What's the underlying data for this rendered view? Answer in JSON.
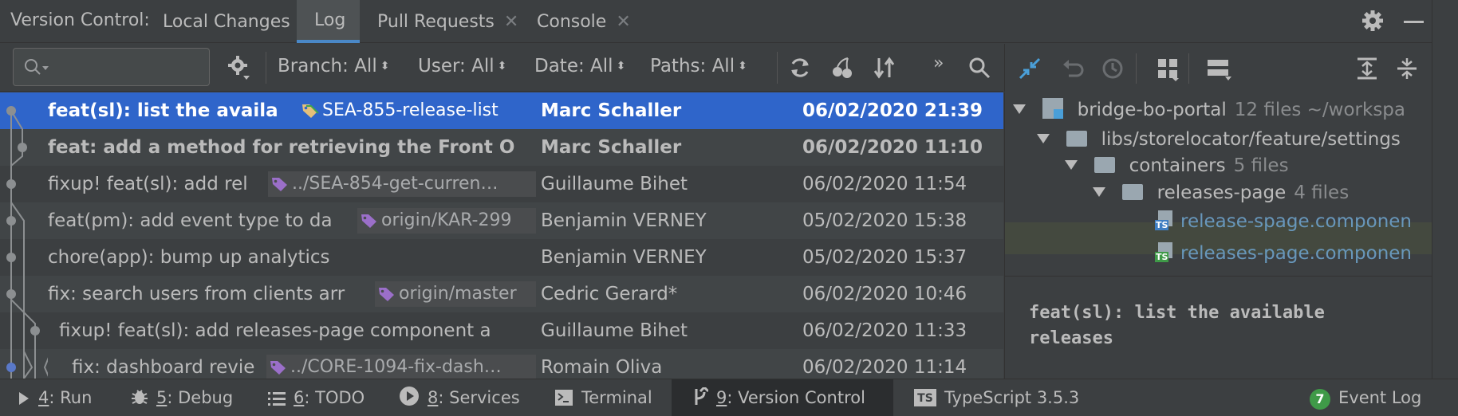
{
  "tabs": {
    "title": "Version Control:",
    "items": [
      {
        "label": "Local Changes",
        "closable": false
      },
      {
        "label": "Log",
        "closable": false,
        "active": true
      },
      {
        "label": "Pull Requests",
        "closable": true
      },
      {
        "label": "Console",
        "closable": true
      }
    ]
  },
  "toolbar": {
    "search_placeholder": "",
    "branch": "Branch: All",
    "user": "User: All",
    "date": "Date: All",
    "paths": "Paths: All",
    "more": "»"
  },
  "commits": [
    {
      "message": "feat(sl): list the availa",
      "ref": "SEA-855-release-list",
      "author": "Marc Schaller",
      "date": "06/02/2020 21:39",
      "selected": true,
      "bold": true
    },
    {
      "message": "feat: add a method for retrieving the Front O",
      "ref": "",
      "author": "Marc Schaller",
      "date": "06/02/2020 11:10",
      "bold": true
    },
    {
      "message": "fixup! feat(sl): add rel",
      "ref": "../SEA-854-get-curren…",
      "author": "Guillaume Bihet",
      "date": "06/02/2020 11:54"
    },
    {
      "message": "feat(pm): add event type to da",
      "ref": "origin/KAR-299",
      "author": "Benjamin VERNEY",
      "date": "05/02/2020 15:38"
    },
    {
      "message": "chore(app): bump up analytics",
      "ref": "",
      "author": "Benjamin VERNEY",
      "date": "05/02/2020 15:37"
    },
    {
      "message": "fix: search users from clients arr",
      "ref": "origin/master",
      "author": "Cedric Gerard*",
      "date": "06/02/2020 10:46"
    },
    {
      "message": "fixup! feat(sl): add releases-page component a",
      "ref": "",
      "author": "Guillaume Bihet",
      "date": "06/02/2020 11:33"
    },
    {
      "message": "fix: dashboard revie",
      "ref": "../CORE-1094-fix-dash…",
      "author": "Romain Oliva",
      "date": "06/02/2020 11:14"
    }
  ],
  "changes": {
    "tree": [
      {
        "name": "bridge-bo-portal",
        "meta": "12 files  ~/workspa"
      },
      {
        "name": "libs/storelocator/feature/settings",
        "meta": ""
      },
      {
        "name": "containers",
        "meta": "5 files"
      },
      {
        "name": "releases-page",
        "meta": "4 files"
      },
      {
        "name": "release-spage.componen",
        "meta": ""
      },
      {
        "name": "releases-page.componen",
        "meta": ""
      }
    ],
    "commit_message": "feat(sl): list the available releases"
  },
  "statusbar": {
    "run_num": "4",
    "run": ": Run",
    "debug_num": "5",
    "debug": ": Debug",
    "todo_num": "6",
    "todo": ": TODO",
    "services_num": "8",
    "services": ": Services",
    "terminal": "Terminal",
    "vc_num": "9",
    "vc": ": Version Control",
    "typescript": "TypeScript 3.5.3",
    "eventlog_count": "7",
    "eventlog": "Event Log"
  },
  "colors": {
    "selection": "#2f65ca",
    "tab_underline": "#4a88c7",
    "file_link": "#6897bb",
    "tag_icon_selected": "#e5c07b",
    "tag_icon": "#9b6fc9",
    "event_badge": "#3f9a48"
  }
}
